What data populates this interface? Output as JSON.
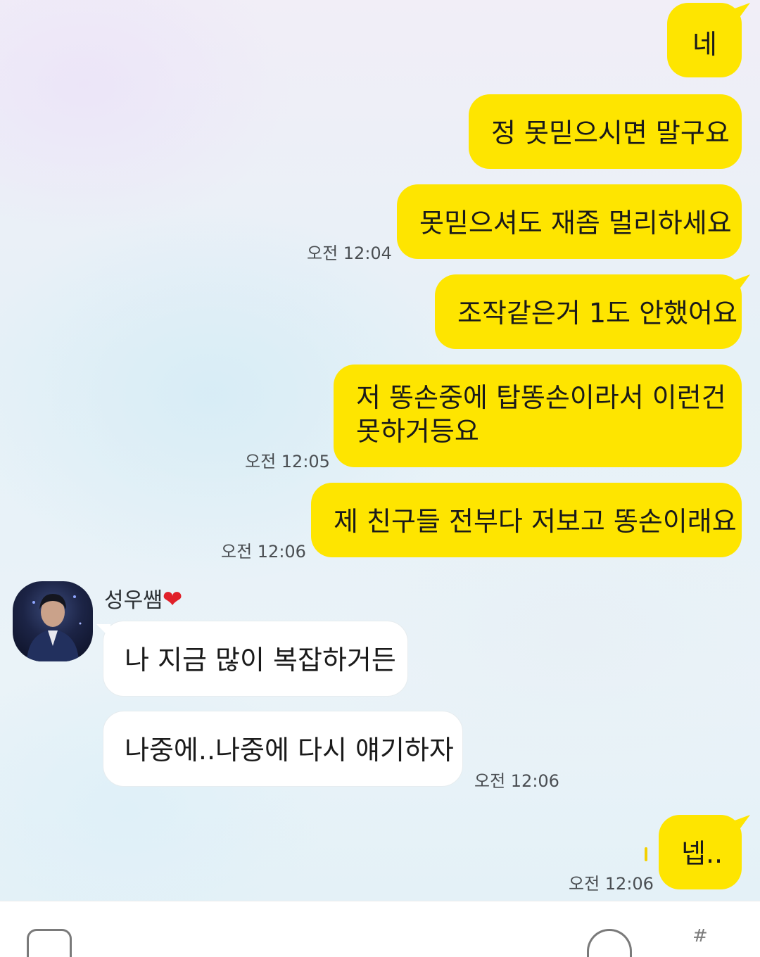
{
  "messages": {
    "m1": {
      "text": "네"
    },
    "m2": {
      "text": "정 못믿으시면 말구요"
    },
    "m3": {
      "text": "못믿으셔도 재좀 멀리하세요",
      "time": "오전 12:04"
    },
    "m4": {
      "text": "조작같은거 1도 안했어요"
    },
    "m5": {
      "line1": "저 똥손중에 탑똥손이라서 이런건",
      "line2": "못하거등요",
      "time": "오전 12:05"
    },
    "m6": {
      "text": "제 친구들 전부다 저보고 똥손이래요",
      "time": "오전 12:06"
    },
    "m7": {
      "text": "나 지금 많이 복잡하거든"
    },
    "m8": {
      "text": "나중에..나중에 다시 얘기하자",
      "time": "오전 12:06"
    },
    "m9": {
      "text": "넵..",
      "time": "오전 12:06"
    }
  },
  "sender": {
    "name": "성우쌤",
    "heart": "❤"
  },
  "input_bar": {
    "hash_icon": "#"
  },
  "colors": {
    "my_bubble": "#fee500",
    "their_bubble": "#ffffff"
  }
}
